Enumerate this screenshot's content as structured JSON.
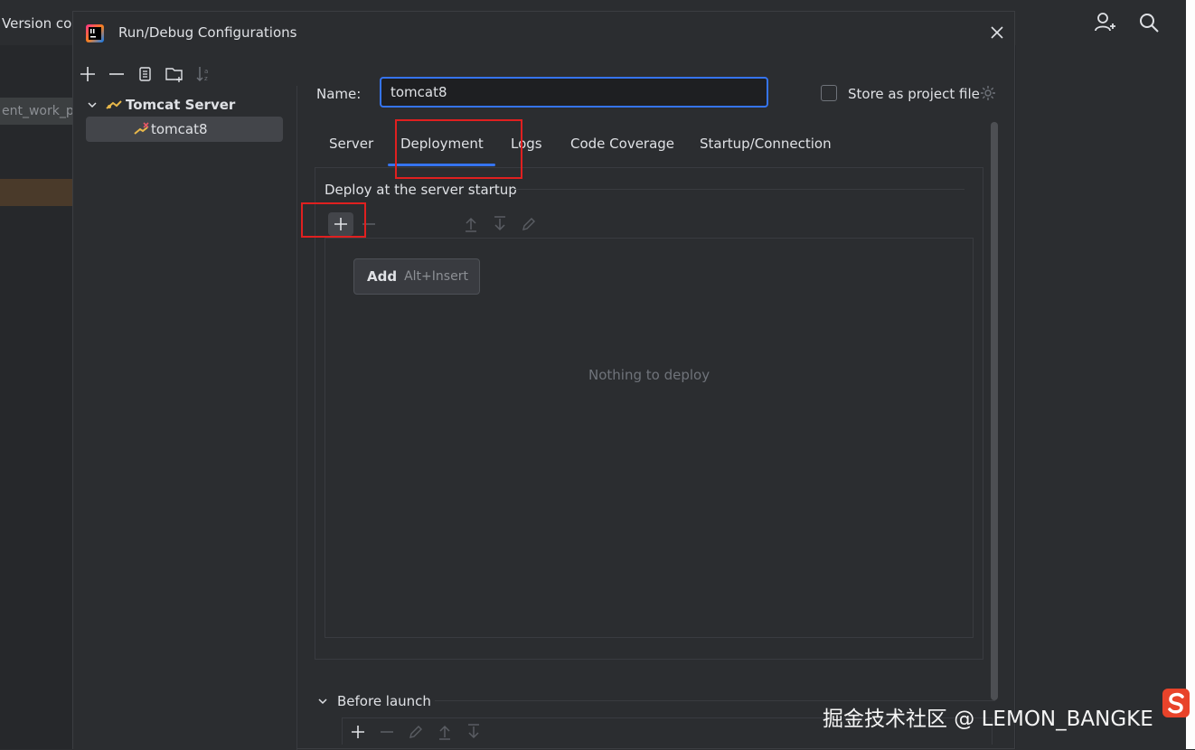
{
  "ide": {
    "left_text": "Version co",
    "left_strip_text": "ent_work_p"
  },
  "dialog": {
    "title": "Run/Debug Configurations"
  },
  "tree": {
    "group_label": "Tomcat Server",
    "item_label": "tomcat8"
  },
  "form": {
    "name_label": "Name:",
    "name_value": "tomcat8",
    "store_label": "Store as project file"
  },
  "tabs": [
    "Server",
    "Deployment",
    "Logs",
    "Code Coverage",
    "Startup/Connection"
  ],
  "deploy": {
    "title": "Deploy at the server startup",
    "empty_text": "Nothing to deploy"
  },
  "tooltip": {
    "action": "Add",
    "shortcut": "Alt+Insert"
  },
  "before_launch": {
    "label": "Before launch"
  },
  "watermark": "掘金技术社区 @ LEMON_BANGKE",
  "colors": {
    "accent": "#3574f0",
    "highlight": "#e02020",
    "background": "#2b2d30"
  }
}
